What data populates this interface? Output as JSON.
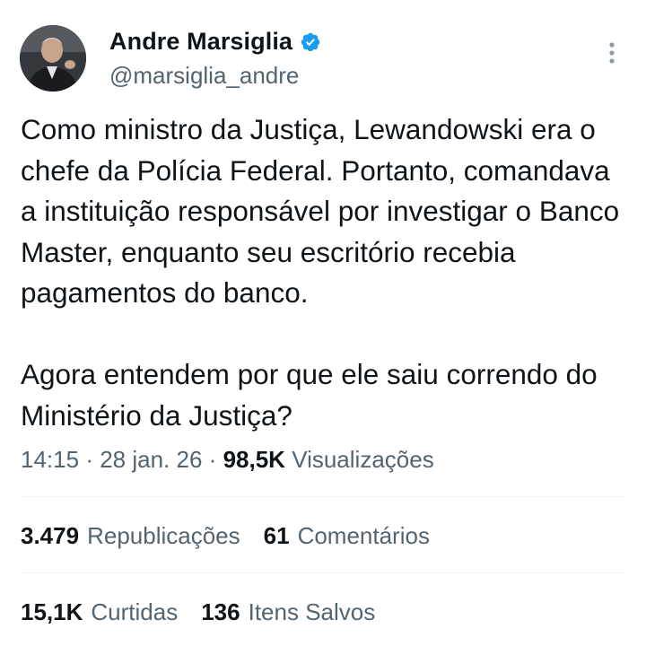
{
  "author": {
    "display_name": "Andre Marsiglia",
    "handle": "@marsiglia_andre",
    "verified_icon": "verified-badge-icon",
    "badge_color": "#1d9bf0"
  },
  "tweet": {
    "paragraph_1": "Como ministro da Justiça, Lewandowski era o chefe da Polícia Federal. Portanto, comandava a instituição responsável por investigar o Banco Master, enquanto seu escritório recebia pagamentos do banco.",
    "paragraph_2": "Agora entendem por que ele saiu correndo do Ministério da Justiça?"
  },
  "meta": {
    "time": "14:15",
    "separator": "·",
    "date": "28 jan. 26",
    "views_count": "98,5K",
    "views_label": "Visualizações"
  },
  "stats": {
    "reposts_count": "3.479",
    "reposts_label": "Republicações",
    "comments_count": "61",
    "comments_label": "Comentários",
    "likes_count": "15,1K",
    "likes_label": "Curtidas",
    "saves_count": "136",
    "saves_label": "Itens Salvos"
  },
  "icons": {
    "more": "more-vertical-icon"
  },
  "colors": {
    "text_primary": "#0f1419",
    "text_secondary": "#536471",
    "divider": "#eff3f4"
  }
}
